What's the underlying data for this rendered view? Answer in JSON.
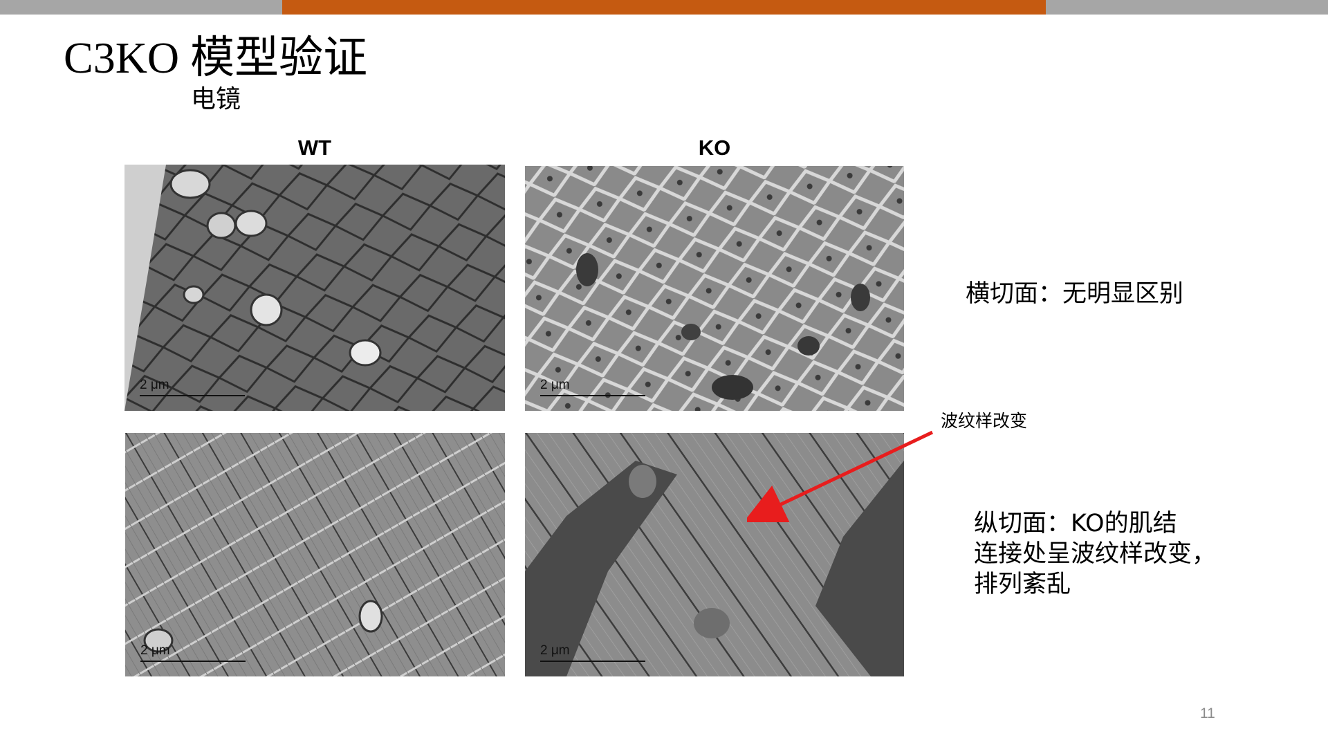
{
  "slide": {
    "title": "C3KO 模型验证",
    "subtitle": "电镜",
    "page_number": "11"
  },
  "columns": {
    "wt": "WT",
    "ko": "KO"
  },
  "images": {
    "scale_bar_label": "2 μm",
    "panels": [
      {
        "name": "wt-cross-section",
        "description": "WT transverse section micrograph"
      },
      {
        "name": "ko-cross-section",
        "description": "KO transverse section micrograph"
      },
      {
        "name": "wt-longitudinal-section",
        "description": "WT longitudinal section micrograph"
      },
      {
        "name": "ko-longitudinal-section",
        "description": "KO longitudinal section micrograph"
      }
    ]
  },
  "annotations": {
    "cross_section_note": "横切面：无明显区别",
    "wave_label": "波纹样改变",
    "longitudinal_note": [
      "纵切面：KO的肌结",
      "连接处呈波纹样改变，",
      "排列紊乱"
    ],
    "arrow_color": "#e81d1d"
  },
  "colors": {
    "accent_bar": "#c55a11",
    "grey_bar": "#a6a6a6"
  }
}
